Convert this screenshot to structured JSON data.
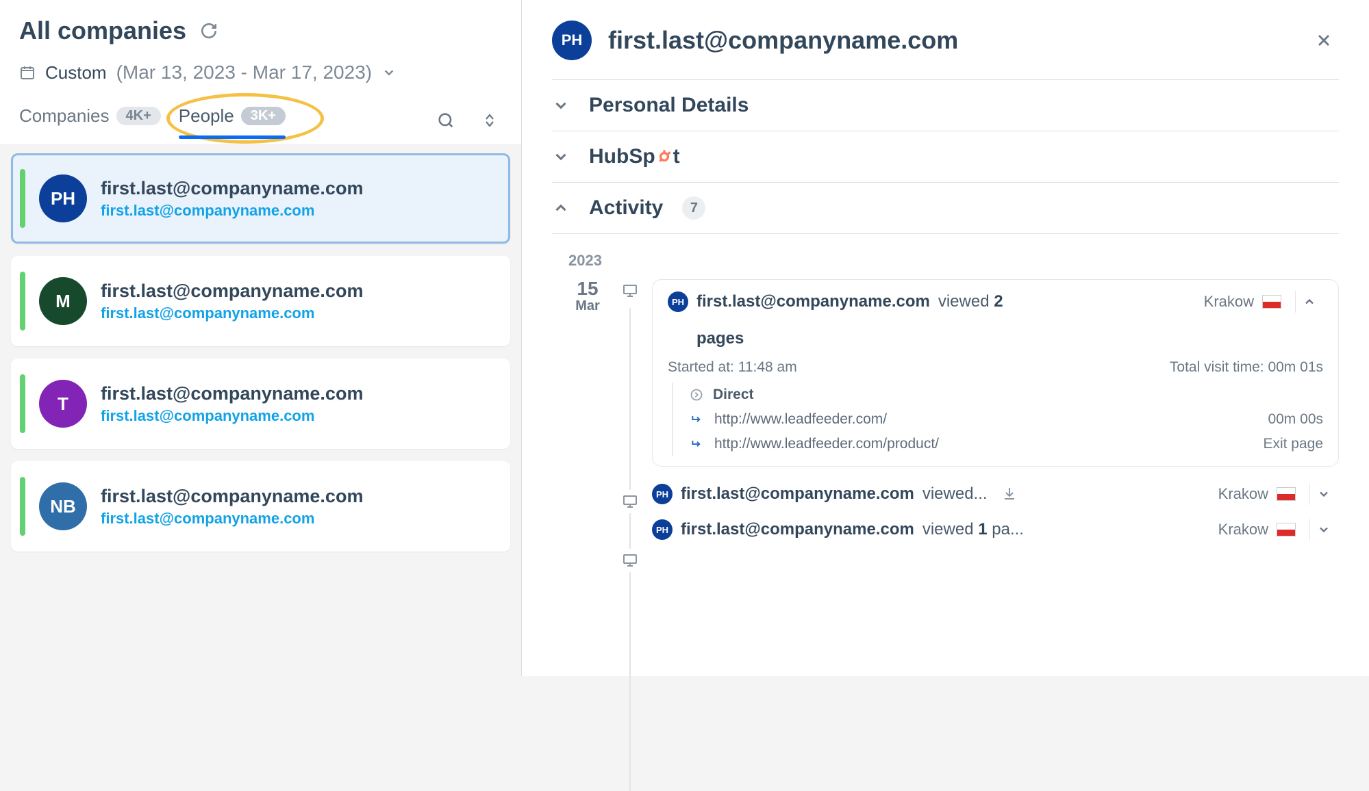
{
  "page_title": "All companies",
  "date_filter": {
    "label": "Custom",
    "range_text": "(Mar 13, 2023 - Mar 17, 2023)"
  },
  "tabs": {
    "companies": {
      "label": "Companies",
      "count_pill": "4K+"
    },
    "people": {
      "label": "People",
      "count_pill": "3K+"
    }
  },
  "list": [
    {
      "initials": "PH",
      "title": "first.last@companyname.com",
      "subtitle": "first.last@companyname.com",
      "avatar_color": "#0c3f99",
      "selected": true
    },
    {
      "initials": "M",
      "title": "first.last@companyname.com",
      "subtitle": "first.last@companyname.com",
      "avatar_color": "#174a2c",
      "selected": false
    },
    {
      "initials": "T",
      "title": "first.last@companyname.com",
      "subtitle": "first.last@companyname.com",
      "avatar_color": "#8224b5",
      "selected": false
    },
    {
      "initials": "NB",
      "title": "first.last@companyname.com",
      "subtitle": "first.last@companyname.com",
      "avatar_color": "#2f6ea8",
      "selected": false
    }
  ],
  "detail": {
    "avatar_initials": "PH",
    "avatar_color": "#0c3f99",
    "title": "first.last@companyname.com",
    "sections": {
      "personal": {
        "title": "Personal Details"
      },
      "hubspot": {
        "logo_text": "HubSpot"
      },
      "activity": {
        "title": "Activity",
        "count": "7"
      }
    },
    "activity": {
      "year": "2023",
      "timeline_day": "15",
      "timeline_month": "Mar",
      "expanded": {
        "user": "first.last@companyname.com",
        "viewed_text": "viewed",
        "pages_count": "2",
        "pages_word": "pages",
        "location": "Krakow",
        "started_label": "Started at:",
        "started_time": "11:48 am",
        "total_label": "Total visit time:",
        "total_time": "00m 01s",
        "source_label": "Direct",
        "urls": [
          {
            "url": "http://www.leadfeeder.com/",
            "duration": "00m 00s"
          },
          {
            "url": "http://www.leadfeeder.com/product/",
            "duration": "Exit page"
          }
        ]
      },
      "collapsed": [
        {
          "user": "first.last@companyname.com",
          "tail": "viewed...",
          "location": "Krakow",
          "show_download": true
        },
        {
          "user": "first.last@companyname.com",
          "tail_pre": "viewed ",
          "tail_bold": "1",
          "tail_post": " pa...",
          "location": "Krakow",
          "show_download": false
        }
      ]
    }
  }
}
